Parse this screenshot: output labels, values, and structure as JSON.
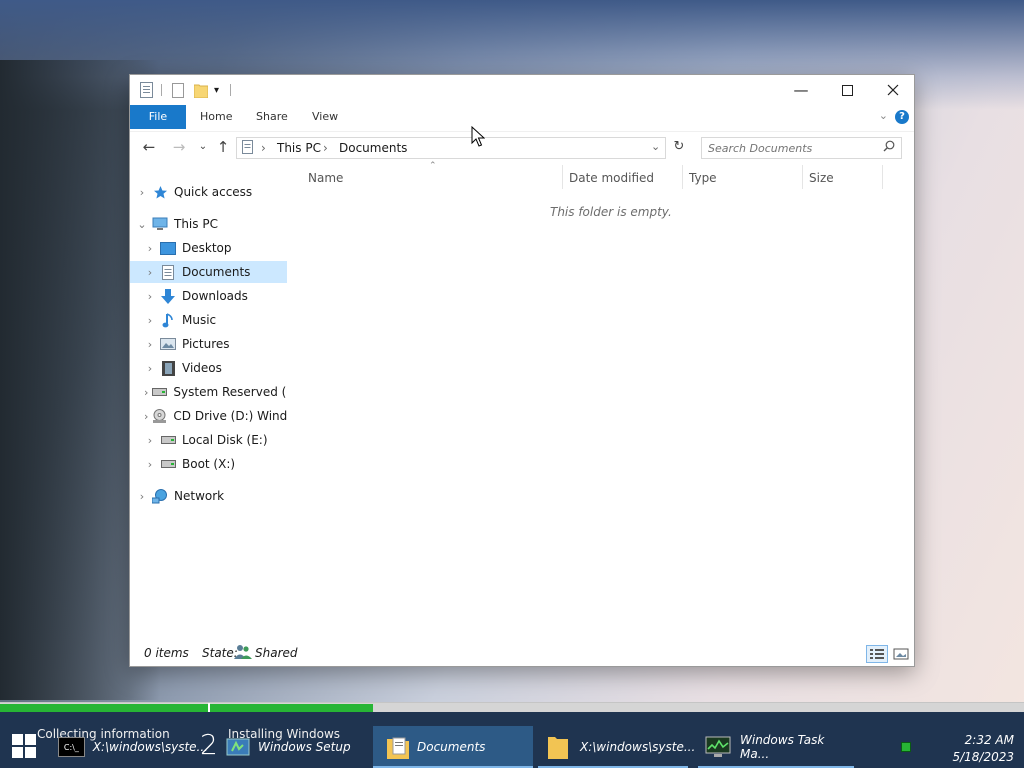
{
  "window": {
    "tabs": [
      {
        "label": "File"
      },
      {
        "label": "Home"
      },
      {
        "label": "Share"
      },
      {
        "label": "View"
      }
    ],
    "help_label": "?"
  },
  "address": {
    "segments": [
      "This PC",
      "Documents"
    ]
  },
  "search": {
    "placeholder": "Search Documents"
  },
  "sidebar": {
    "items": [
      {
        "label": "Quick access"
      },
      {
        "label": "This PC"
      },
      {
        "label": "Desktop"
      },
      {
        "label": "Documents"
      },
      {
        "label": "Downloads"
      },
      {
        "label": "Music"
      },
      {
        "label": "Pictures"
      },
      {
        "label": "Videos"
      },
      {
        "label": "System Reserved (C:)"
      },
      {
        "label": "CD Drive (D:) Windows"
      },
      {
        "label": "Local Disk (E:)"
      },
      {
        "label": "Boot (X:)"
      },
      {
        "label": "Network"
      }
    ]
  },
  "columns": [
    "Name",
    "Date modified",
    "Type",
    "Size"
  ],
  "content": {
    "empty_message": "This folder is empty."
  },
  "status": {
    "items": "0 items",
    "state_label": "State:",
    "state_value": "Shared"
  },
  "setup_progress": {
    "step1_fraction": 1.0,
    "step2_fraction": 0.2
  },
  "taskbar": {
    "step1_label": "Collecting information",
    "step2_label": "Installing Windows",
    "step2_number": "2",
    "apps": [
      {
        "label": "X:\\windows\\syste..."
      },
      {
        "label": "Windows Setup"
      },
      {
        "label": "Documents"
      },
      {
        "label": "X:\\windows\\syste..."
      },
      {
        "label": "Windows Task Ma..."
      }
    ],
    "time": "2:32 AM",
    "date": "5/18/2023"
  },
  "colors": {
    "accent": "#1979ca",
    "selection": "#cce8ff",
    "progress": "#27b535",
    "taskbar": "#1f3450"
  }
}
